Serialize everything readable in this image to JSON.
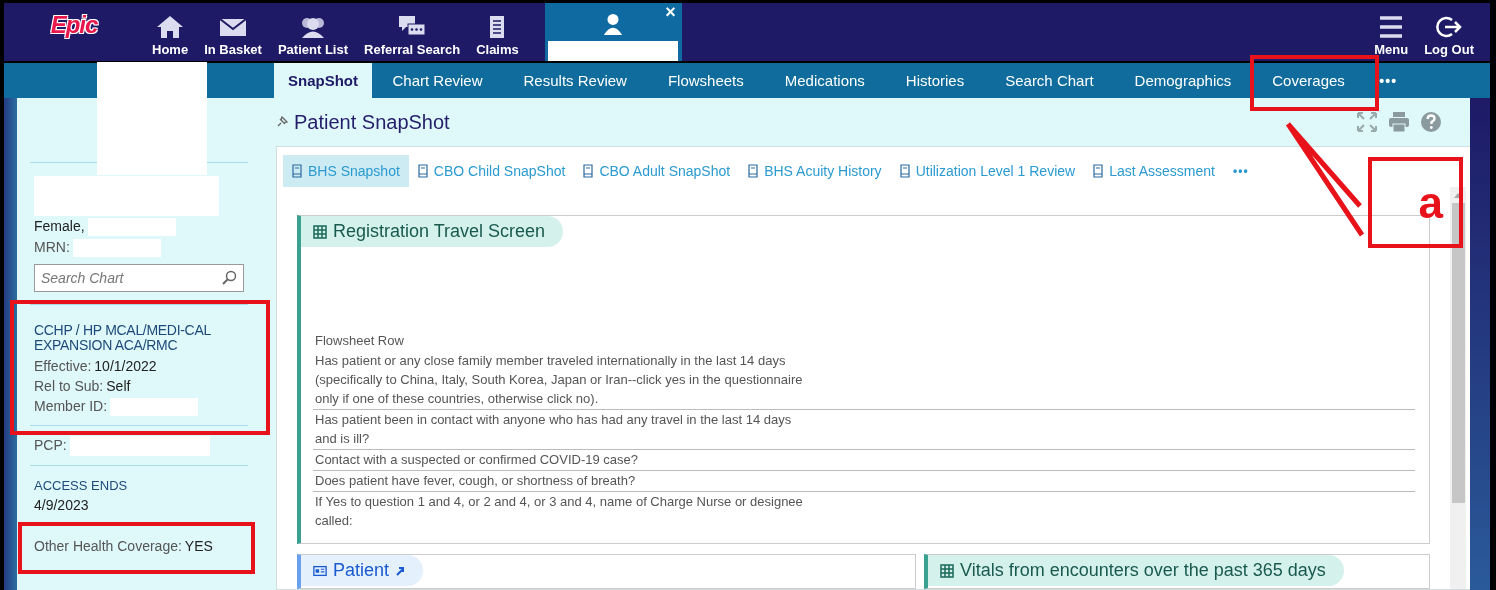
{
  "top_nav": {
    "logo": "Epic",
    "items": [
      {
        "label": "Home"
      },
      {
        "label": "In Basket"
      },
      {
        "label": "Patient List"
      },
      {
        "label": "Referral Search"
      },
      {
        "label": "Claims"
      }
    ],
    "patient_tab": {
      "close": "×"
    },
    "right_items": [
      {
        "label": "Menu"
      },
      {
        "label": "Log Out"
      }
    ]
  },
  "tabs": [
    {
      "label": "SnapShot",
      "selected": true
    },
    {
      "label": "Chart Review",
      "selected": false
    },
    {
      "label": "Results Review",
      "selected": false
    },
    {
      "label": "Flowsheets",
      "selected": false
    },
    {
      "label": "Medications",
      "selected": false
    },
    {
      "label": "Histories",
      "selected": false
    },
    {
      "label": "Search Chart",
      "selected": false
    },
    {
      "label": "Demographics",
      "selected": false
    },
    {
      "label": "Coverages",
      "selected": false
    }
  ],
  "tabs_more": "•••",
  "sidebar": {
    "sex": "Female,",
    "mrn_label": "MRN:",
    "search": {
      "placeholder": "Search Chart"
    },
    "coverage": {
      "plan": "CCHP / HP MCAL/MEDI-CAL EXPANSION ACA/RMC",
      "fields": [
        {
          "label": "Effective:",
          "value": "10/1/2022"
        },
        {
          "label": "Rel to Sub:",
          "value": "Self"
        },
        {
          "label": "Member ID:"
        }
      ]
    },
    "pcp_label": "PCP:",
    "access": {
      "label": "ACCESS ENDS",
      "date": "4/9/2023"
    },
    "other_coverage": {
      "label": "Other Health Coverage:",
      "value": "YES"
    }
  },
  "page": {
    "title": "Patient SnapShot",
    "subtabs": [
      {
        "label": "BHS Snapshot",
        "selected": true
      },
      {
        "label": "CBO Child SnapShot",
        "selected": false
      },
      {
        "label": "CBO Adult SnapShot",
        "selected": false
      },
      {
        "label": "BHS Acuity History",
        "selected": false
      },
      {
        "label": "Utilization Level 1 Review",
        "selected": false
      },
      {
        "label": "Last Assessment",
        "selected": false
      }
    ],
    "subtabs_more": "•••",
    "travel_screen": {
      "title": "Registration Travel Screen",
      "row_header": "Flowsheet Row",
      "rows": [
        "Has patient or any close family member traveled internationally in the last 14 days (specifically to China, Italy, South Korea, Japan or Iran--click yes in the questionnaire only if one of these countries, otherwise click no).",
        "Has patient been in contact with anyone who has had any travel in the last 14 days and is ill?",
        "Contact with a suspected or confirmed COVID-19 case?",
        "Does patient have fever, cough, or shortness of breath?",
        "If Yes to question 1 and 4, or 2 and 4, or 3 and 4, name of Charge Nurse or designee called:"
      ]
    },
    "patient_card": {
      "title": "Patient"
    },
    "vitals_card": {
      "title": "Vitals from encounters over the past 365 days"
    }
  },
  "annotation": {
    "label": "a"
  }
}
